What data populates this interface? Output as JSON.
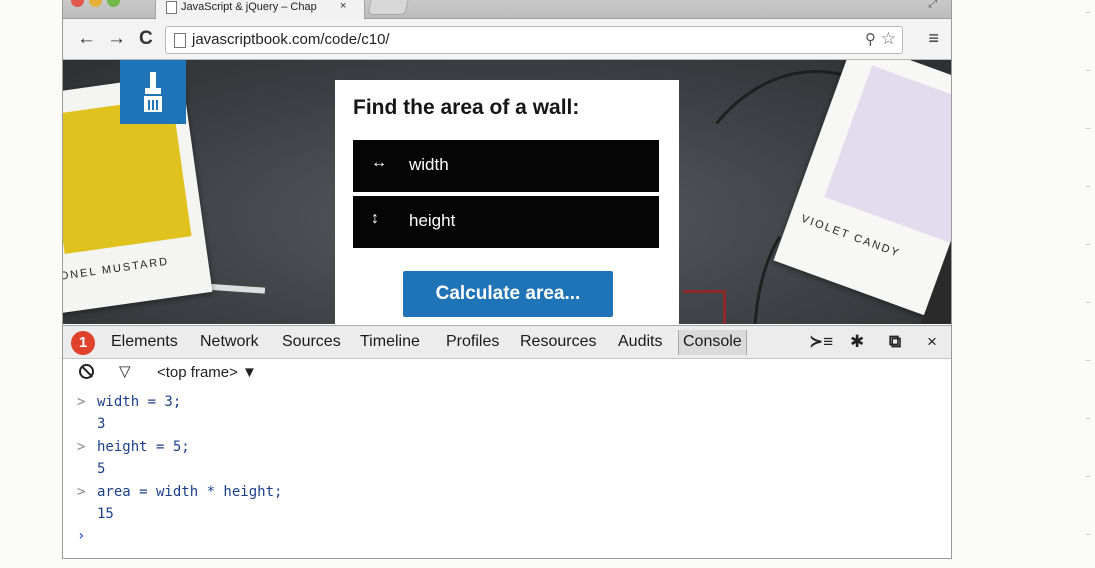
{
  "browser": {
    "tab_title": "JavaScript & jQuery – Chap",
    "tab_close": "×",
    "url": "javascriptbook.com/code/c10/",
    "back": "←",
    "forward": "→",
    "reload": "C",
    "zoom_icon": "zoom-icon",
    "star_icon": "☆",
    "menu_icon": "≡",
    "traffic_colors": [
      "#e2584d",
      "#e5b03a",
      "#72b84b"
    ]
  },
  "page": {
    "form_title": "Find the area of a wall:",
    "fields": [
      {
        "icon": "↔",
        "label": "width"
      },
      {
        "icon": "↕",
        "label": "height"
      }
    ],
    "button": "Calculate area...",
    "swatch_left_label": "ONEL MUSTARD",
    "swatch_right_label": "VIOLET CANDY",
    "accent_color": "#1f74b8"
  },
  "devtools": {
    "marker": "1",
    "tabs": [
      "Elements",
      "Network",
      "Sources",
      "Timeline",
      "Profiles",
      "Resources",
      "Audits",
      "Console"
    ],
    "active_tab": "Console",
    "frame_select": "<top frame> ▼",
    "close": "×",
    "console": [
      {
        "type": "input",
        "prompt": ">",
        "text": "width = 3;"
      },
      {
        "type": "output",
        "text": "3"
      },
      {
        "type": "input",
        "prompt": ">",
        "text": "height = 5;"
      },
      {
        "type": "output",
        "text": "5"
      },
      {
        "type": "input",
        "prompt": ">",
        "text": "area = width * height;"
      },
      {
        "type": "output",
        "text": "15"
      },
      {
        "type": "caret",
        "prompt": "›"
      }
    ]
  }
}
